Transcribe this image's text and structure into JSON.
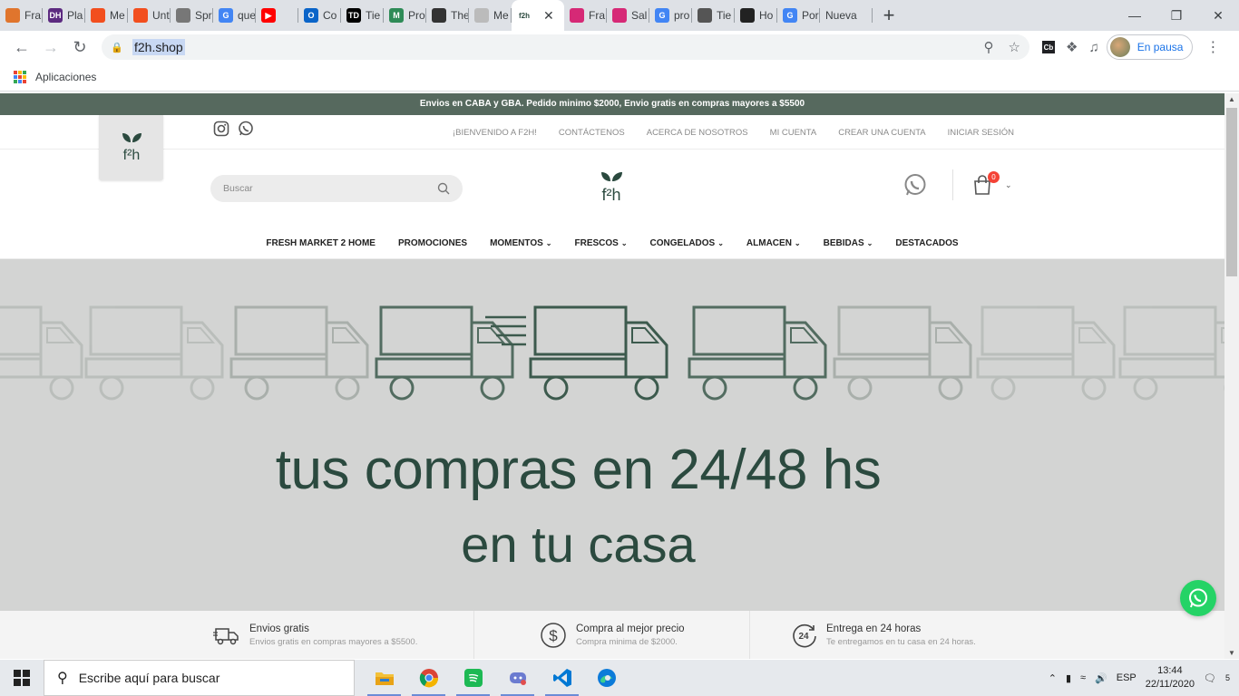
{
  "browser": {
    "tabs": [
      {
        "label": "Fra",
        "color": "#e0752d",
        "glyph": ""
      },
      {
        "label": "Pla",
        "color": "#5c2a80",
        "glyph": "DH"
      },
      {
        "label": "Me",
        "color": "#f24e1e",
        "glyph": ""
      },
      {
        "label": "Unt",
        "color": "#f24e1e",
        "glyph": ""
      },
      {
        "label": "Spr",
        "color": "#777777",
        "glyph": ""
      },
      {
        "label": "que",
        "color": "#4285f4",
        "glyph": "G"
      },
      {
        "label": "",
        "color": "#ff0000",
        "glyph": "▶"
      },
      {
        "label": "Co",
        "color": "#0a64c8",
        "glyph": "O"
      },
      {
        "label": "Tie",
        "color": "#000000",
        "glyph": "TD"
      },
      {
        "label": "Pro",
        "color": "#2e8b57",
        "glyph": "M"
      },
      {
        "label": "The",
        "color": "#333333",
        "glyph": ""
      },
      {
        "label": "Me",
        "color": "#bbbbbb",
        "glyph": ""
      },
      {
        "label": "",
        "color": "#2b4a3f",
        "glyph": "f2h",
        "active": true
      },
      {
        "label": "Fra",
        "color": "#d62976",
        "glyph": ""
      },
      {
        "label": "Sal",
        "color": "#d62976",
        "glyph": ""
      },
      {
        "label": "pro",
        "color": "#4285f4",
        "glyph": "G"
      },
      {
        "label": "Tie",
        "color": "#555555",
        "glyph": ""
      },
      {
        "label": "Ho",
        "color": "#222222",
        "glyph": ""
      },
      {
        "label": "Por",
        "color": "#4285f4",
        "glyph": "G"
      }
    ],
    "new_tab_label": "Nueva",
    "url": "f2h.shop",
    "profile_label": "En pausa",
    "bookmarks_label": "Aplicaciones"
  },
  "site": {
    "promo_text": "Envios en CABA y GBA. Pedido minimo $2000, Envio gratis en compras mayores a $5500",
    "top_links": [
      "¡BIENVENIDO A F2H!",
      "CONTÁCTENOS",
      "ACERCA DE NOSOTROS",
      "MI CUENTA",
      "CREAR UNA CUENTA",
      "INICIAR SESIÓN"
    ],
    "search_placeholder": "Buscar",
    "cart_count": "0",
    "nav": [
      {
        "label": "FRESH MARKET 2 HOME",
        "has_menu": false
      },
      {
        "label": "PROMOCIONES",
        "has_menu": false
      },
      {
        "label": "MOMENTOS",
        "has_menu": true
      },
      {
        "label": "FRESCOS",
        "has_menu": true
      },
      {
        "label": "CONGELADOS",
        "has_menu": true
      },
      {
        "label": "ALMACEN",
        "has_menu": true
      },
      {
        "label": "BEBIDAS",
        "has_menu": true
      },
      {
        "label": "DESTACADOS",
        "has_menu": false
      }
    ],
    "hero": {
      "line1": "tus compras en 24/48 hs",
      "line2": "en tu casa"
    },
    "features": [
      {
        "title": "Envios gratis",
        "subtitle": "Envios gratis en compras mayores a $5500.",
        "icon": "truck-icon"
      },
      {
        "title": "Compra al mejor precio",
        "subtitle": "Compra minima de $2000.",
        "icon": "dollar-icon"
      },
      {
        "title": "Entrega en 24 horas",
        "subtitle": "Te entregamos en tu casa en 24 horas.",
        "icon": "24h-icon"
      }
    ],
    "brand_color": "#2b4a3f",
    "promo_bar_color": "#56695e"
  },
  "taskbar": {
    "search_placeholder": "Escribe aquí para buscar",
    "language": "ESP",
    "time": "13:44",
    "date": "22/11/2020",
    "notification_count": "5"
  }
}
